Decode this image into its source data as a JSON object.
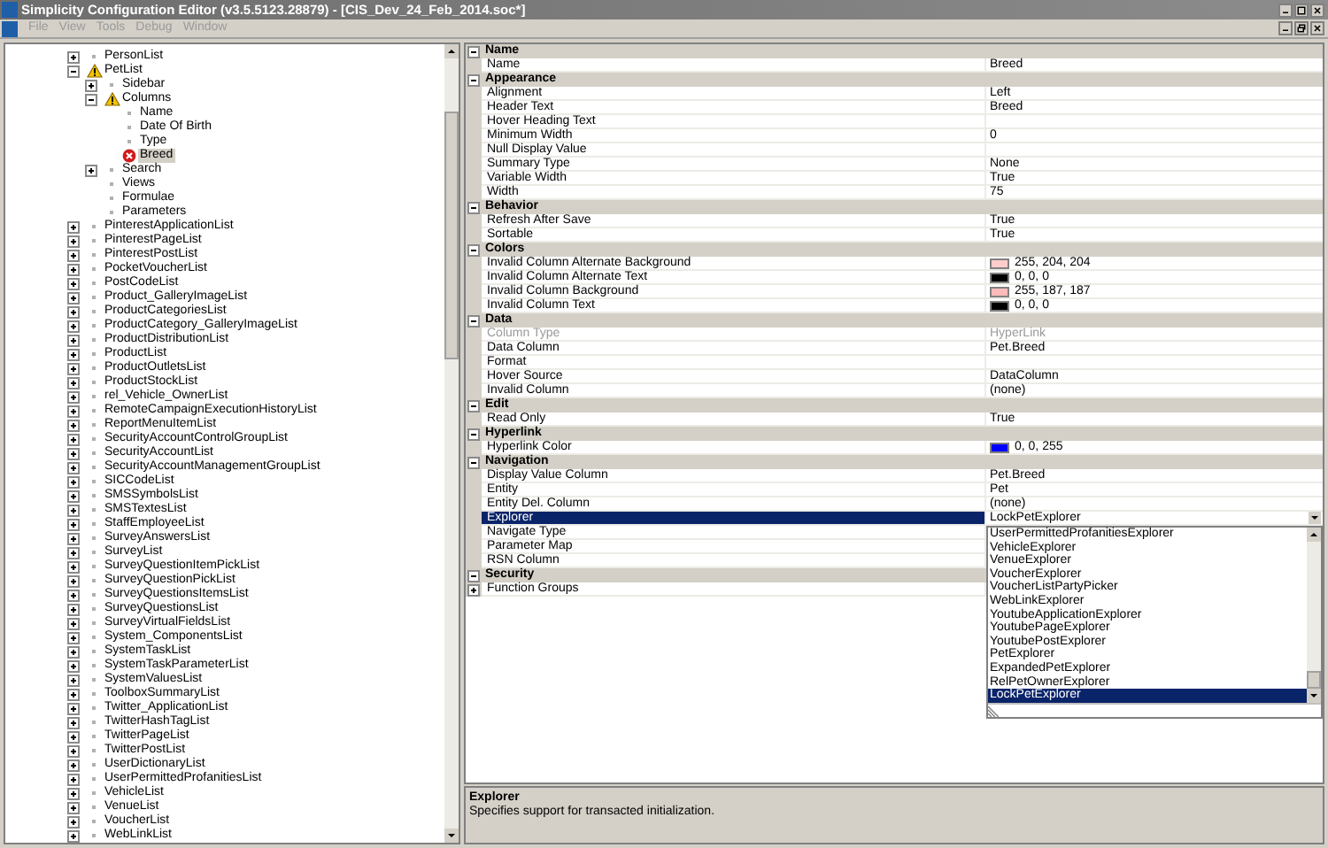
{
  "window": {
    "title": "Simplicity Configuration Editor (v3.5.5123.28879) - [CIS_Dev_24_Feb_2014.soc*]"
  },
  "menu": [
    "File",
    "View",
    "Tools",
    "Debug",
    "Window"
  ],
  "tree": [
    {
      "label": "PersonList",
      "kind": "plain",
      "expanded": false,
      "selected": false
    },
    {
      "label": "PetList",
      "kind": "warning",
      "expanded": true,
      "selected": false,
      "children": [
        {
          "label": "Sidebar",
          "kind": "plain",
          "expanded": false,
          "selected": false
        },
        {
          "label": "Columns",
          "kind": "warning",
          "expanded": true,
          "selected": false,
          "children": [
            {
              "label": "Name",
              "kind": "plain",
              "selected": false
            },
            {
              "label": "Date Of Birth",
              "kind": "plain",
              "selected": false
            },
            {
              "label": "Type",
              "kind": "plain",
              "selected": false
            },
            {
              "label": "Breed",
              "kind": "error",
              "selected": true
            }
          ]
        },
        {
          "label": "Search",
          "kind": "plain",
          "expanded": false,
          "selected": false
        },
        {
          "label": "Views",
          "kind": "plain",
          "selected": false
        },
        {
          "label": "Formulae",
          "kind": "plain",
          "selected": false
        },
        {
          "label": "Parameters",
          "kind": "plain",
          "selected": false
        }
      ]
    },
    {
      "label": "PinterestApplicationList",
      "kind": "plain",
      "expanded": false,
      "selected": false
    },
    {
      "label": "PinterestPageList",
      "kind": "plain",
      "expanded": false,
      "selected": false
    },
    {
      "label": "PinterestPostList",
      "kind": "plain",
      "expanded": false,
      "selected": false
    },
    {
      "label": "PocketVoucherList",
      "kind": "plain",
      "expanded": false,
      "selected": false
    },
    {
      "label": "PostCodeList",
      "kind": "plain",
      "expanded": false,
      "selected": false
    },
    {
      "label": "Product_GalleryImageList",
      "kind": "plain",
      "expanded": false,
      "selected": false
    },
    {
      "label": "ProductCategoriesList",
      "kind": "plain",
      "expanded": false,
      "selected": false
    },
    {
      "label": "ProductCategory_GalleryImageList",
      "kind": "plain",
      "expanded": false,
      "selected": false
    },
    {
      "label": "ProductDistributionList",
      "kind": "plain",
      "expanded": false,
      "selected": false
    },
    {
      "label": "ProductList",
      "kind": "plain",
      "expanded": false,
      "selected": false
    },
    {
      "label": "ProductOutletsList",
      "kind": "plain",
      "expanded": false,
      "selected": false
    },
    {
      "label": "ProductStockList",
      "kind": "plain",
      "expanded": false,
      "selected": false
    },
    {
      "label": "rel_Vehicle_OwnerList",
      "kind": "plain",
      "expanded": false,
      "selected": false
    },
    {
      "label": "RemoteCampaignExecutionHistoryList",
      "kind": "plain",
      "expanded": false,
      "selected": false
    },
    {
      "label": "ReportMenuItemList",
      "kind": "plain",
      "expanded": false,
      "selected": false
    },
    {
      "label": "SecurityAccountControlGroupList",
      "kind": "plain",
      "expanded": false,
      "selected": false
    },
    {
      "label": "SecurityAccountList",
      "kind": "plain",
      "expanded": false,
      "selected": false
    },
    {
      "label": "SecurityAccountManagementGroupList",
      "kind": "plain",
      "expanded": false,
      "selected": false
    },
    {
      "label": "SICCodeList",
      "kind": "plain",
      "expanded": false,
      "selected": false
    },
    {
      "label": "SMSSymbolsList",
      "kind": "plain",
      "expanded": false,
      "selected": false
    },
    {
      "label": "SMSTextesList",
      "kind": "plain",
      "expanded": false,
      "selected": false
    },
    {
      "label": "StaffEmployeeList",
      "kind": "plain",
      "expanded": false,
      "selected": false
    },
    {
      "label": "SurveyAnswersList",
      "kind": "plain",
      "expanded": false,
      "selected": false
    },
    {
      "label": "SurveyList",
      "kind": "plain",
      "expanded": false,
      "selected": false
    },
    {
      "label": "SurveyQuestionItemPickList",
      "kind": "plain",
      "expanded": false,
      "selected": false
    },
    {
      "label": "SurveyQuestionPickList",
      "kind": "plain",
      "expanded": false,
      "selected": false
    },
    {
      "label": "SurveyQuestionsItemsList",
      "kind": "plain",
      "expanded": false,
      "selected": false
    },
    {
      "label": "SurveyQuestionsList",
      "kind": "plain",
      "expanded": false,
      "selected": false
    },
    {
      "label": "SurveyVirtualFieldsList",
      "kind": "plain",
      "expanded": false,
      "selected": false
    },
    {
      "label": "System_ComponentsList",
      "kind": "plain",
      "expanded": false,
      "selected": false
    },
    {
      "label": "SystemTaskList",
      "kind": "plain",
      "expanded": false,
      "selected": false
    },
    {
      "label": "SystemTaskParameterList",
      "kind": "plain",
      "expanded": false,
      "selected": false
    },
    {
      "label": "SystemValuesList",
      "kind": "plain",
      "expanded": false,
      "selected": false
    },
    {
      "label": "ToolboxSummaryList",
      "kind": "plain",
      "expanded": false,
      "selected": false
    },
    {
      "label": "Twitter_ApplicationList",
      "kind": "plain",
      "expanded": false,
      "selected": false
    },
    {
      "label": "TwitterHashTagList",
      "kind": "plain",
      "expanded": false,
      "selected": false
    },
    {
      "label": "TwitterPageList",
      "kind": "plain",
      "expanded": false,
      "selected": false
    },
    {
      "label": "TwitterPostList",
      "kind": "plain",
      "expanded": false,
      "selected": false
    },
    {
      "label": "UserDictionaryList",
      "kind": "plain",
      "expanded": false,
      "selected": false
    },
    {
      "label": "UserPermittedProfanitiesList",
      "kind": "plain",
      "expanded": false,
      "selected": false
    },
    {
      "label": "VehicleList",
      "kind": "plain",
      "expanded": false,
      "selected": false
    },
    {
      "label": "VenueList",
      "kind": "plain",
      "expanded": false,
      "selected": false
    },
    {
      "label": "VoucherList",
      "kind": "plain",
      "expanded": false,
      "selected": false
    },
    {
      "label": "WebLinkList",
      "kind": "plain",
      "expanded": false,
      "selected": false
    }
  ],
  "categories": [
    {
      "name": "Name",
      "expanded": true,
      "properties": [
        {
          "name": "Name",
          "value": "Breed",
          "kind": "text",
          "selected": false,
          "disabled": false
        }
      ]
    },
    {
      "name": "Appearance",
      "expanded": true,
      "properties": [
        {
          "name": "Alignment",
          "value": "Left",
          "kind": "text",
          "selected": false,
          "disabled": false
        },
        {
          "name": "Header Text",
          "value": "Breed",
          "kind": "text",
          "selected": false,
          "disabled": false
        },
        {
          "name": "Hover Heading Text",
          "kind": "text",
          "selected": false,
          "disabled": false
        },
        {
          "name": "Minimum Width",
          "value": "0",
          "kind": "text",
          "selected": false,
          "disabled": false
        },
        {
          "name": "Null Display Value",
          "kind": "text",
          "selected": false,
          "disabled": false
        },
        {
          "name": "Summary Type",
          "value": "None",
          "kind": "text",
          "selected": false,
          "disabled": false
        },
        {
          "name": "Variable Width",
          "value": "True",
          "kind": "text",
          "selected": false,
          "disabled": false
        },
        {
          "name": "Width",
          "value": "75",
          "kind": "text",
          "selected": false,
          "disabled": false
        }
      ]
    },
    {
      "name": "Behavior",
      "expanded": true,
      "properties": [
        {
          "name": "Refresh After Save",
          "value": "True",
          "kind": "text",
          "selected": false,
          "disabled": false
        },
        {
          "name": "Sortable",
          "value": "True",
          "kind": "text",
          "selected": false,
          "disabled": false
        }
      ]
    },
    {
      "name": "Colors",
      "expanded": true,
      "properties": [
        {
          "name": "Invalid Column Alternate Background",
          "value": "255, 204, 204",
          "kind": "color",
          "color": "#ffcccc",
          "selected": false,
          "disabled": false
        },
        {
          "name": "Invalid Column Alternate Text",
          "value": "0, 0, 0",
          "kind": "color",
          "color": "#000000",
          "selected": false,
          "disabled": false
        },
        {
          "name": "Invalid Column Background",
          "value": "255, 187, 187",
          "kind": "color",
          "color": "#ffbbbb",
          "selected": false,
          "disabled": false
        },
        {
          "name": "Invalid Column Text",
          "value": "0, 0, 0",
          "kind": "color",
          "color": "#000000",
          "selected": false,
          "disabled": false
        }
      ]
    },
    {
      "name": "Data",
      "expanded": true,
      "properties": [
        {
          "name": "Column Type",
          "value": "HyperLink",
          "kind": "text",
          "selected": false,
          "disabled": true
        },
        {
          "name": "Data Column",
          "value": "Pet.Breed",
          "kind": "text",
          "selected": false,
          "disabled": false
        },
        {
          "name": "Format",
          "kind": "text",
          "selected": false,
          "disabled": false
        },
        {
          "name": "Hover Source",
          "value": "DataColumn",
          "kind": "text",
          "selected": false,
          "disabled": false
        },
        {
          "name": "Invalid Column",
          "value": "(none)",
          "kind": "text",
          "selected": false,
          "disabled": false
        }
      ]
    },
    {
      "name": "Edit",
      "expanded": true,
      "properties": [
        {
          "name": "Read Only",
          "value": "True",
          "kind": "text",
          "selected": false,
          "disabled": false
        }
      ]
    },
    {
      "name": "Hyperlink",
      "expanded": true,
      "properties": [
        {
          "name": "Hyperlink Color",
          "value": "0, 0, 255",
          "kind": "color",
          "color": "#0000ff",
          "selected": false,
          "disabled": false
        }
      ]
    },
    {
      "name": "Navigation",
      "expanded": true,
      "properties": [
        {
          "name": "Display Value Column",
          "value": "Pet.Breed",
          "kind": "text",
          "selected": false,
          "disabled": false
        },
        {
          "name": "Entity",
          "value": "Pet",
          "kind": "text",
          "selected": false,
          "disabled": false
        },
        {
          "name": "Entity Del. Column",
          "value": "(none)",
          "kind": "text",
          "selected": false,
          "disabled": false
        },
        {
          "name": "Explorer",
          "value": "LockPetExplorer",
          "kind": "dropdown",
          "open": true,
          "selected": true,
          "disabled": false,
          "options": [
            {
              "label": "UserPermittedProfanitiesExplorer",
              "selected": false
            },
            {
              "label": "VehicleExplorer",
              "selected": false
            },
            {
              "label": "VenueExplorer",
              "selected": false
            },
            {
              "label": "VoucherExplorer",
              "selected": false
            },
            {
              "label": "VoucherListPartyPicker",
              "selected": false
            },
            {
              "label": "WebLinkExplorer",
              "selected": false
            },
            {
              "label": "YoutubeApplicationExplorer",
              "selected": false
            },
            {
              "label": "YoutubePageExplorer",
              "selected": false
            },
            {
              "label": "YoutubePostExplorer",
              "selected": false
            },
            {
              "label": "PetExplorer",
              "selected": false
            },
            {
              "label": "ExpandedPetExplorer",
              "selected": false
            },
            {
              "label": "RelPetOwnerExplorer",
              "selected": false
            },
            {
              "label": "LockPetExplorer",
              "selected": true
            }
          ]
        },
        {
          "name": "Navigate Type",
          "kind": "text",
          "selected": false,
          "disabled": false
        },
        {
          "name": "Parameter Map",
          "kind": "text",
          "selected": false,
          "disabled": false
        },
        {
          "name": "RSN Column",
          "kind": "text",
          "selected": false,
          "disabled": false
        }
      ]
    },
    {
      "name": "Security",
      "expanded": true,
      "properties": [
        {
          "name": "Function Groups",
          "kind": "expandable",
          "expanded": false,
          "selected": false,
          "disabled": false
        }
      ]
    }
  ],
  "help": {
    "title": "Explorer",
    "text": "Specifies support for transacted initialization."
  }
}
